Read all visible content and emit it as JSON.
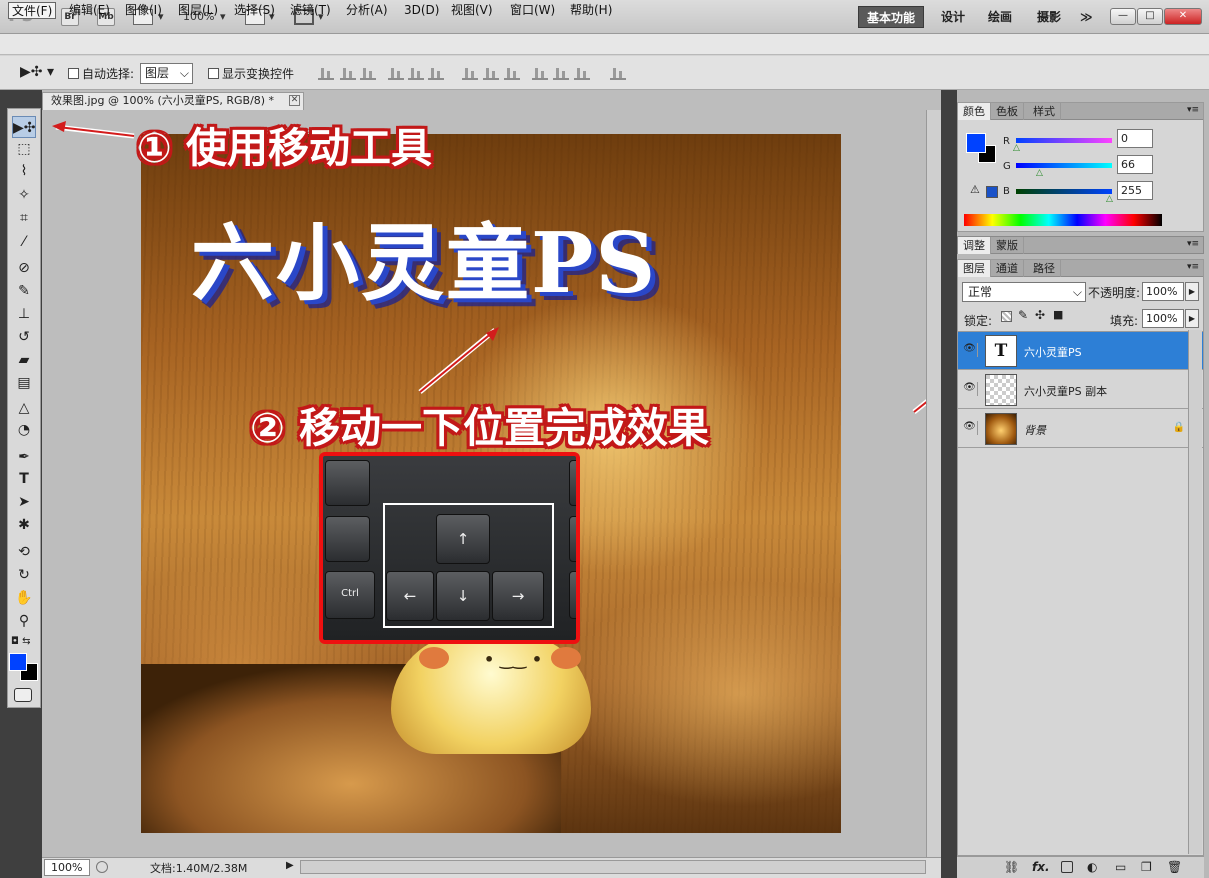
{
  "titlebar": {
    "logo": "Ps",
    "br_label": "Br",
    "mb_label": "Mb",
    "zoom": "100%",
    "workspaces": [
      "基本功能",
      "设计",
      "绘画",
      "摄影"
    ],
    "more": "≫"
  },
  "menubar": [
    "文件(F)",
    "编辑(E)",
    "图像(I)",
    "图层(L)",
    "选择(S)",
    "滤镜(T)",
    "分析(A)",
    "3D(D)",
    "视图(V)",
    "窗口(W)",
    "帮助(H)"
  ],
  "options": {
    "auto_select_label": "自动选择:",
    "auto_select_value": "图层",
    "show_transform_label": "显示变换控件"
  },
  "document": {
    "tab_title": "效果图.jpg @ 100% (六小灵童PS, RGB/8) *",
    "canvas_title": "六小灵童PS",
    "annotation1": "① 使用移动工具",
    "annotation2": "② 移动一下位置完成效果",
    "keys": {
      "ctrl": "Ctrl",
      "up": "↑",
      "left": "←",
      "down": "↓",
      "right": "→"
    }
  },
  "status": {
    "zoom": "100%",
    "doc_info": "文档:1.40M/2.38M"
  },
  "color_panel": {
    "tabs": [
      "颜色",
      "色板",
      "样式"
    ],
    "r_label": "R",
    "r_value": "0",
    "g_label": "G",
    "g_value": "66",
    "b_label": "B",
    "b_value": "255",
    "fg_color": "#0042FF"
  },
  "adjust_panel": {
    "tabs": [
      "调整",
      "蒙版"
    ]
  },
  "layers_panel": {
    "tabs": [
      "图层",
      "通道",
      "路径"
    ],
    "blend_mode": "正常",
    "opacity_label": "不透明度:",
    "opacity_value": "100%",
    "lock_label": "锁定:",
    "fill_label": "填充:",
    "fill_value": "100%",
    "layers": [
      {
        "name": "六小灵童PS",
        "thumb": "T"
      },
      {
        "name": "六小灵童PS 副本",
        "thumb": ""
      },
      {
        "name": "背景",
        "thumb": ""
      }
    ],
    "footer_icons": [
      "link-icon",
      "fx-icon",
      "mask-icon",
      "adjustment-icon",
      "group-icon",
      "new-layer-icon",
      "trash-icon"
    ]
  }
}
